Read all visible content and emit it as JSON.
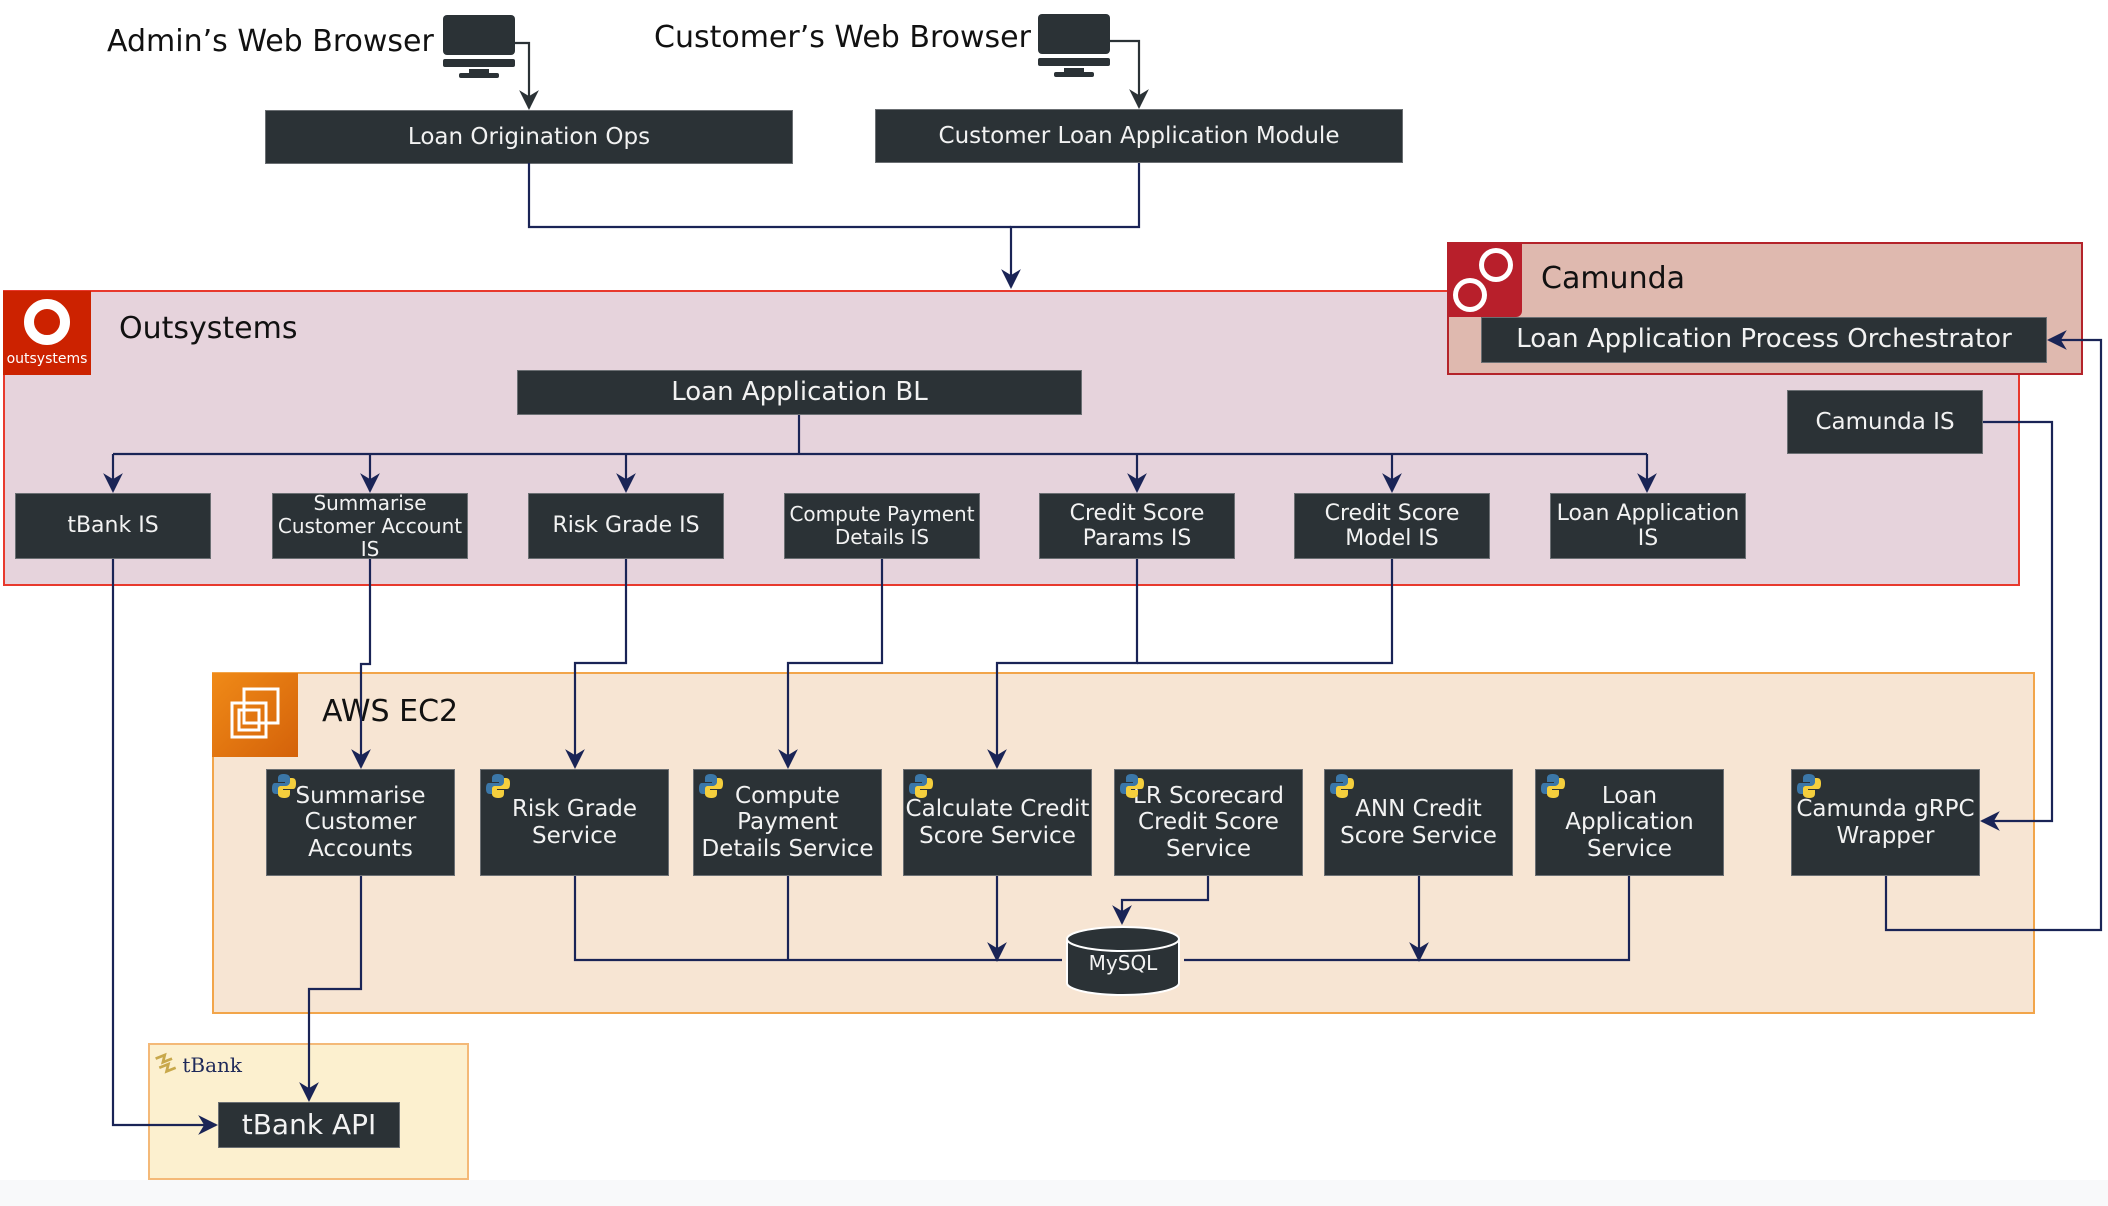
{
  "clients": {
    "admin_label": "Admin’s Web Browser",
    "customer_label": "Customer’s Web Browser"
  },
  "frontends": {
    "loan_origination_ops": "Loan Origination Ops",
    "customer_loan_module": "Customer Loan Application Module"
  },
  "outsystems": {
    "logo_text": "outsystems",
    "title": "Outsystems",
    "business_logic": "Loan Application BL",
    "integration_services": [
      "tBank IS",
      "Summarise Customer Account  IS",
      "Risk Grade IS",
      "Compute Payment Details IS",
      "Credit Score Params IS",
      "Credit Score Model IS",
      "Loan Application IS"
    ],
    "camunda_is": "Camunda IS"
  },
  "camunda": {
    "title": "Camunda",
    "orchestrator": "Loan Application Process Orchestrator"
  },
  "aws": {
    "title": "AWS EC2",
    "services": [
      "Summarise Customer Accounts",
      "Risk Grade Service",
      "Compute Payment Details Service",
      "Calculate Credit Score Service",
      "LR Scorecard Credit Score Service",
      "ANN Credit Score Service",
      "Loan Application Service",
      "Camunda gRPC Wrapper"
    ],
    "database": "MySQL"
  },
  "tbank": {
    "logo_text": "tBank",
    "api": "tBank API"
  },
  "colors": {
    "box_fill": "#2b3236",
    "connector": "#1a2456",
    "outsystems_border": "#e8392d",
    "outsystems_fill": "#e6d3dc",
    "camunda_fill": "#dfb9af",
    "camunda_red": "#b81f2b",
    "aws_fill": "#f7e5d3",
    "aws_orange": "#f08a17",
    "tbank_fill": "#fcf0cf"
  }
}
